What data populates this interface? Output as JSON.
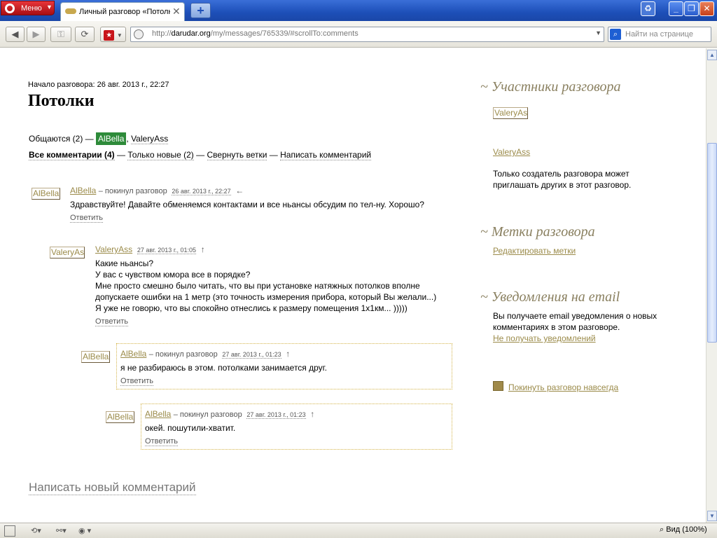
{
  "browser": {
    "menu_label": "Меню",
    "tab_title": "Личный разговор «Потолки»",
    "address": {
      "scheme": "http://",
      "domain": "darudar.org",
      "path": "/my/messages/765339/#scrollTo:comments"
    },
    "search_placeholder": "Найти на странице",
    "zoom_label": "Вид (100%)"
  },
  "conversation": {
    "started_label": "Начало разговора: 26 авг. 2013 г., 22:27",
    "title": "Потолки",
    "participants_prefix": "Общаются (2) —",
    "participants": [
      "AlBella",
      "ValeryAss"
    ],
    "filters": {
      "all": "Все комментарии (4)",
      "sep": "—",
      "new": "Только новые (2)",
      "collapse": "Свернуть ветки",
      "write": "Написать комментарий"
    },
    "write_new": "Написать новый комментарий"
  },
  "comments": [
    {
      "author": "AlBella",
      "status": "– покинул разговор",
      "date": "26 авг. 2013 г., 22:27",
      "arrow": "←",
      "lines": [
        "Здравствуйте! Давайте обменяемся контактами и все ньансы обсудим по тел-ну. Хорошо?"
      ],
      "reply": "Ответить"
    },
    {
      "author": "ValeryAss",
      "status": "",
      "date": "27 авг. 2013 г., 01:05",
      "arrow": "↑",
      "lines": [
        "Какие ньансы?",
        "У вас с чувством юмора все в порядке?",
        "Мне просто смешно было читать, что вы при установке натяжных потолков вполне",
        "допускаете ошибки на 1 метр (это точность измерения прибора, который Вы желали...)",
        "Я уже не говорю, что вы спокойно отнеслись к размеру помещения 1х1км... )))))"
      ],
      "reply": "Ответить"
    },
    {
      "author": "AlBella",
      "status": "– покинул разговор",
      "date": "27 авг. 2013 г., 01:23",
      "arrow": "↑",
      "lines": [
        "я не разбираюсь в этом. потолками занимается друг."
      ],
      "reply": "Ответить"
    },
    {
      "author": "AlBella",
      "status": "– покинул разговор",
      "date": "27 авг. 2013 г., 01:23",
      "arrow": "↑",
      "lines": [
        "окей. пошутили-хватит."
      ],
      "reply": "Ответить"
    }
  ],
  "sidebar": {
    "participants_title": "Участники разговора",
    "avatar_label": "ValeryAss",
    "participant_name": "ValeryAss",
    "invite_note": [
      "Только создатель разговора может",
      "приглашать других в этот разговор."
    ],
    "tags_title": "Метки разговора",
    "edit_tags": "Редактировать метки",
    "notify_title": "Уведомления на email",
    "notify_note": [
      "Вы получаете email уведомления о новых",
      "комментариях в этом разговоре."
    ],
    "unsubscribe": "Не получать уведомлений",
    "leave": "Покинуть разговор навсегда",
    "tilde": "~"
  },
  "colors": {
    "accent_link": "#9b8b4a",
    "highlight": "#2e8b3a",
    "box_border": "#d4b44a",
    "menu_red": "#c8151a"
  }
}
